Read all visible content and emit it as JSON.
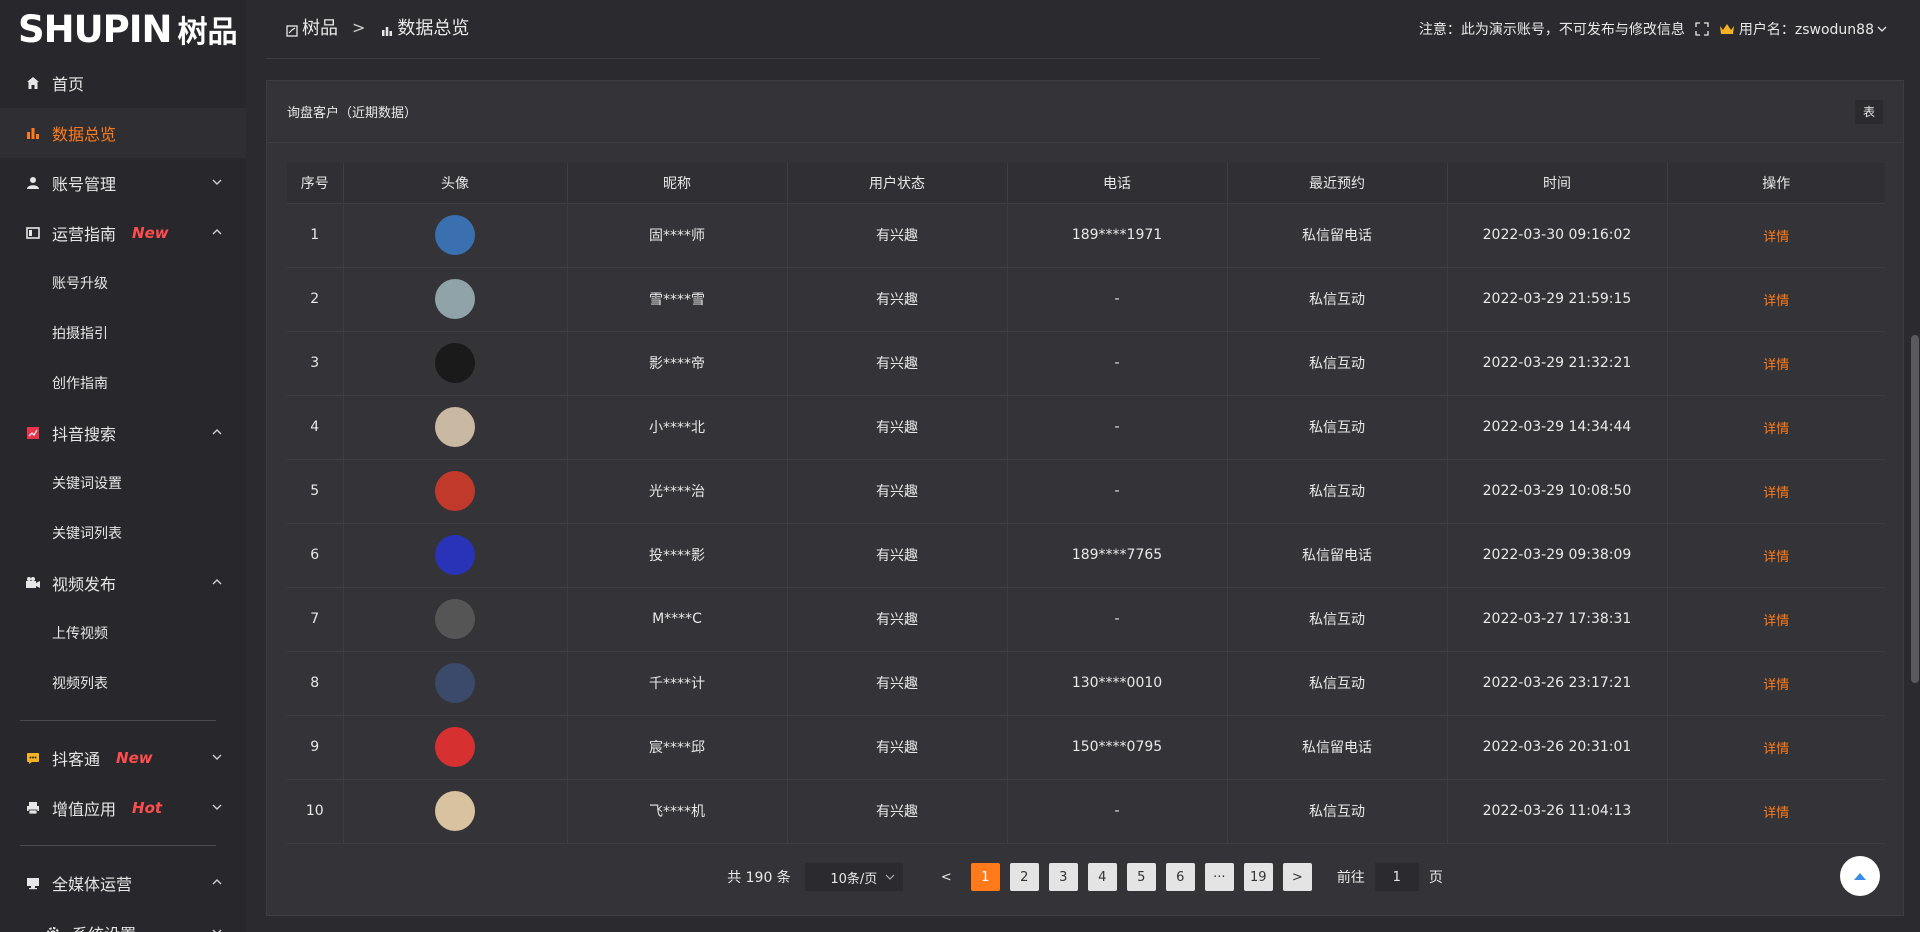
{
  "brand": {
    "logo_en": "SHUPIN",
    "logo_cn": "树品"
  },
  "sidebar": {
    "items": [
      {
        "label": "首页",
        "icon": "home-icon"
      },
      {
        "label": "数据总览",
        "icon": "bar-chart-icon",
        "active": true
      },
      {
        "label": "账号管理",
        "icon": "user-icon",
        "arrow": "down"
      },
      {
        "label": "运营指南",
        "icon": "book-icon",
        "tag": "New",
        "arrow": "up",
        "children": [
          "账号升级",
          "拍摄指引",
          "创作指南"
        ]
      },
      {
        "label": "抖音搜索",
        "icon": "trend-icon",
        "arrow": "up",
        "children": [
          "关键词设置",
          "关键词列表"
        ]
      },
      {
        "label": "视频发布",
        "icon": "camera-icon",
        "arrow": "up",
        "children": [
          "上传视频",
          "视频列表"
        ]
      },
      {
        "label": "抖客通",
        "icon": "chat-icon",
        "tag": "New",
        "arrow": "down"
      },
      {
        "label": "增值应用",
        "icon": "printer-icon",
        "tag": "Hot",
        "arrow": "down"
      },
      {
        "label": "全媒体运营",
        "icon": "monitor-icon",
        "arrow": "up"
      },
      {
        "label": "系统设置",
        "icon": "gear-icon",
        "arrow": "down"
      }
    ]
  },
  "header": {
    "breadcrumb": [
      "树品",
      "数据总览"
    ],
    "breadcrumb_sep": ">",
    "notice": "注意：此为演示账号，不可发布与修改信息",
    "user_label": "用户名：zswodun88"
  },
  "card": {
    "title": "询盘客户（近期数据）",
    "head_button": "表"
  },
  "table": {
    "columns": [
      "序号",
      "头像",
      "昵称",
      "用户状态",
      "电话",
      "最近预约",
      "时间",
      "操作"
    ],
    "rows": [
      {
        "no": "1",
        "avatar_color": "#3a6fb0",
        "nick": "固****师",
        "status": "有兴趣",
        "phone": "189****1971",
        "booking": "私信留电话",
        "time": "2022-03-30 09:16:02",
        "action": "详情"
      },
      {
        "no": "2",
        "avatar_color": "#8fa3a8",
        "nick": "雪****雪",
        "status": "有兴趣",
        "phone": "-",
        "booking": "私信互动",
        "time": "2022-03-29 21:59:15",
        "action": "详情"
      },
      {
        "no": "3",
        "avatar_color": "#1a1a1a",
        "nick": "影****帝",
        "status": "有兴趣",
        "phone": "-",
        "booking": "私信互动",
        "time": "2022-03-29 21:32:21",
        "action": "详情"
      },
      {
        "no": "4",
        "avatar_color": "#c9b8a2",
        "nick": "小****北",
        "status": "有兴趣",
        "phone": "-",
        "booking": "私信互动",
        "time": "2022-03-29 14:34:44",
        "action": "详情"
      },
      {
        "no": "5",
        "avatar_color": "#c0392b",
        "nick": "光****治",
        "status": "有兴趣",
        "phone": "-",
        "booking": "私信互动",
        "time": "2022-03-29 10:08:50",
        "action": "详情"
      },
      {
        "no": "6",
        "avatar_color": "#2833b8",
        "nick": "投****影",
        "status": "有兴趣",
        "phone": "189****7765",
        "booking": "私信留电话",
        "time": "2022-03-29 09:38:09",
        "action": "详情"
      },
      {
        "no": "7",
        "avatar_color": "#555555",
        "nick": "M****C",
        "status": "有兴趣",
        "phone": "-",
        "booking": "私信互动",
        "time": "2022-03-27 17:38:31",
        "action": "详情"
      },
      {
        "no": "8",
        "avatar_color": "#3b4a6b",
        "nick": "千****计",
        "status": "有兴趣",
        "phone": "130****0010",
        "booking": "私信互动",
        "time": "2022-03-26 23:17:21",
        "action": "详情"
      },
      {
        "no": "9",
        "avatar_color": "#d63031",
        "nick": "宸****邱",
        "status": "有兴趣",
        "phone": "150****0795",
        "booking": "私信留电话",
        "time": "2022-03-26 20:31:01",
        "action": "详情"
      },
      {
        "no": "10",
        "avatar_color": "#d9c2a0",
        "nick": "飞****机",
        "status": "有兴趣",
        "phone": "-",
        "booking": "私信互动",
        "time": "2022-03-26 11:04:13",
        "action": "详情"
      }
    ]
  },
  "pagination": {
    "total": "共 190 条",
    "page_size": "10条/页",
    "prev": "<",
    "pages": [
      "1",
      "2",
      "3",
      "4",
      "5",
      "6",
      "···",
      "19"
    ],
    "current": "1",
    "next": ">",
    "goto_label": "前往",
    "goto_value": "1",
    "goto_suffix": "页"
  },
  "colors": {
    "accent": "#ff7a1a",
    "tag_red": "#ff4d4f",
    "bg": "#2b2b2f",
    "card": "#343438"
  }
}
